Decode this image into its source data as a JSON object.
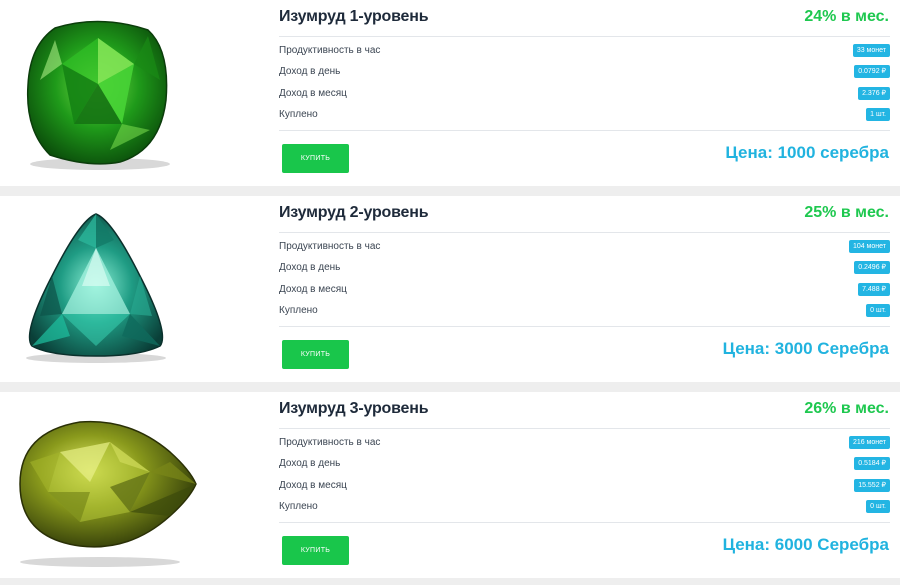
{
  "labels": {
    "productivity": "Продуктивность в час",
    "daily_income": "Доход в день",
    "monthly_income": "Доход в месяц",
    "purchased": "Куплено",
    "buy_button": "КУПИТЬ"
  },
  "colors": {
    "rate_green": "#1ec84f",
    "price_blue": "#21b3df",
    "badge_blue": "#23b5e3",
    "button_green": "#19c64b"
  },
  "cards": [
    {
      "title": "Изумруд 1-уровень",
      "rate": "24% в мес.",
      "productivity": "33 монет",
      "daily_income": "0.0792 ₽",
      "monthly_income": "2.376 ₽",
      "purchased": "1 шт.",
      "price": "Цена: 1000 серебра",
      "gem_icon": "green-cushion-gem-icon"
    },
    {
      "title": "Изумруд 2-уровень",
      "rate": "25% в мес.",
      "productivity": "104 монет",
      "daily_income": "0.2496 ₽",
      "monthly_income": "7.488 ₽",
      "purchased": "0 шт.",
      "price": "Цена: 3000 Серебра",
      "gem_icon": "teal-trillion-gem-icon"
    },
    {
      "title": "Изумруд 3-уровень",
      "rate": "26% в мес.",
      "productivity": "216 монет",
      "daily_income": "0.5184 ₽",
      "monthly_income": "15.552 ₽",
      "purchased": "0 шт.",
      "price": "Цена: 6000 Серебра",
      "gem_icon": "olive-pear-gem-icon"
    }
  ]
}
